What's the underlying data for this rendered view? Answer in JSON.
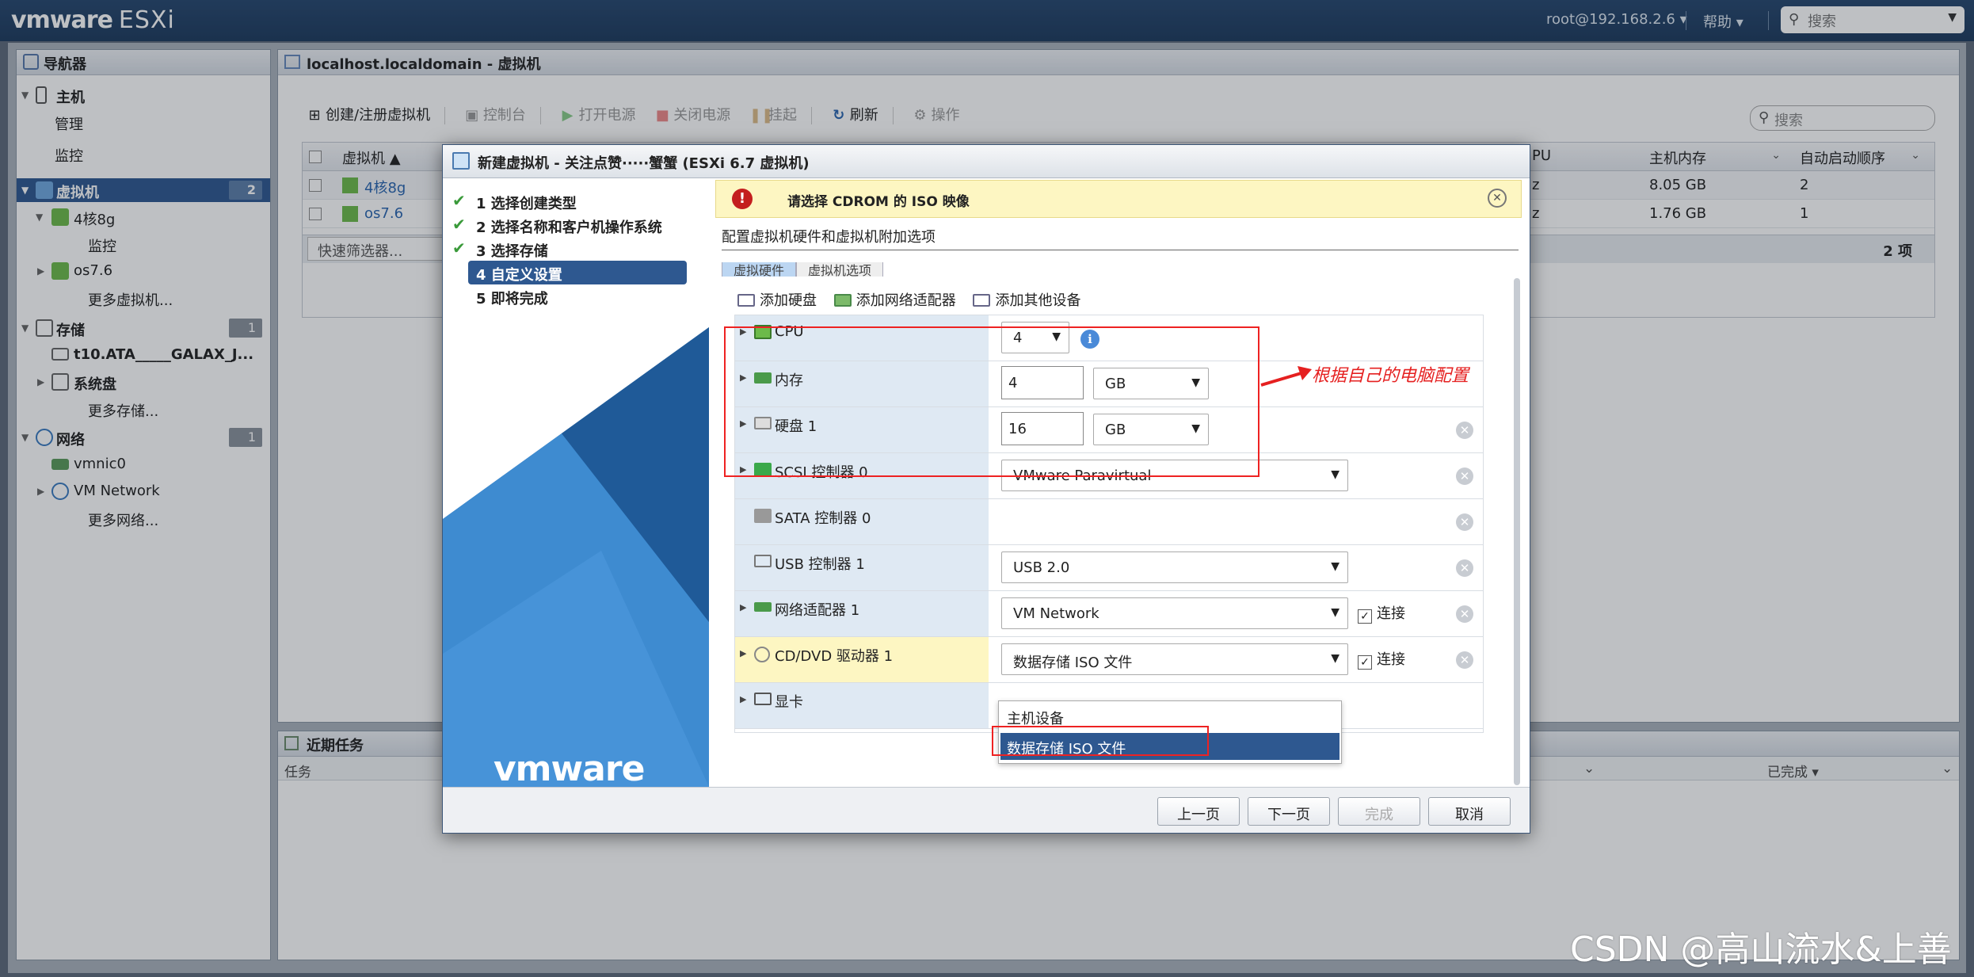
{
  "app": {
    "brand": "vmware",
    "product": "ESXi",
    "user": "root@192.168.2.6 ▾",
    "help": "帮助 ▾",
    "search_placeholder": "搜索"
  },
  "navigator": {
    "title": "导航器",
    "host": "主机",
    "host_manage": "管理",
    "host_monitor": "监控",
    "vms": "虚拟机",
    "vms_count": "2",
    "vm1": "4核8g",
    "vm1_monitor": "监控",
    "vm2": "os7.6",
    "more_vms": "更多虚拟机...",
    "storage": "存储",
    "storage_count": "1",
    "ds1": "t10.ATA_____GALAX_J...",
    "ds2": "系统盘",
    "more_storage": "更多存储...",
    "network": "网络",
    "network_count": "1",
    "net1": "vmnic0",
    "net2": "VM Network",
    "more_network": "更多网络..."
  },
  "main": {
    "title": "localhost.localdomain - 虚拟机",
    "toolbar": {
      "create": "创建/注册虚拟机",
      "console": "控制台",
      "power_on": "打开电源",
      "power_off": "关闭电源",
      "suspend": "挂起",
      "refresh": "刷新",
      "actions": "操作"
    },
    "search_placeholder": "搜索",
    "columns": {
      "vm": "虚拟机 ▲",
      "cpu": "PU",
      "mem": "主机内存",
      "autostart": "自动启动顺序"
    },
    "rows": [
      {
        "name": "4核8g",
        "cpu": "z",
        "mem": "8.05 GB",
        "order": "2"
      },
      {
        "name": "os7.6",
        "cpu": "z",
        "mem": "1.76 GB",
        "order": "1"
      }
    ],
    "quick_filter": "快速筛选器...",
    "count": "2 项"
  },
  "tasks": {
    "title": "近期任务",
    "col_task": "任务",
    "col_done": "已完成 ▾"
  },
  "dialog": {
    "title": "新建虚拟机 - 关注点赞·····蟹蟹 (ESXi 6.7 虚拟机)",
    "steps": [
      {
        "label": "1 选择创建类型",
        "done": true
      },
      {
        "label": "2 选择名称和客户机操作系统",
        "done": true
      },
      {
        "label": "3 选择存储",
        "done": true
      },
      {
        "label": "4 自定义设置",
        "done": false
      },
      {
        "label": "5 即将完成",
        "done": false
      }
    ],
    "warning": "请选择 CDROM 的 ISO 映像",
    "subtitle": "配置虚拟机硬件和虚拟机附加选项",
    "tab_hw": "虚拟硬件",
    "tab_opt": "虚拟机选项",
    "add_disk": "添加硬盘",
    "add_nic": "添加网络适配器",
    "add_other": "添加其他设备",
    "hw": {
      "cpu_label": "CPU",
      "cpu_value": "4",
      "mem_label": "内存",
      "mem_value": "4",
      "mem_unit": "GB",
      "disk_label": "硬盘 1",
      "disk_value": "16",
      "disk_unit": "GB",
      "scsi_label": "SCSI 控制器 0",
      "scsi_value": "VMware Paravirtual",
      "sata_label": "SATA 控制器 0",
      "usb_label": "USB 控制器 1",
      "usb_value": "USB 2.0",
      "nic_label": "网络适配器 1",
      "nic_value": "VM Network",
      "connect": "连接",
      "cd_label": "CD/DVD 驱动器 1",
      "cd_value": "数据存储 ISO 文件",
      "display_label": "显卡"
    },
    "dropdown_options": [
      "主机设备",
      "数据存储 ISO 文件"
    ],
    "buttons": {
      "back": "上一页",
      "next": "下一页",
      "finish": "完成",
      "cancel": "取消"
    }
  },
  "annotation": "根据自己的电脑配置",
  "watermark": "CSDN @高山流水&上善"
}
